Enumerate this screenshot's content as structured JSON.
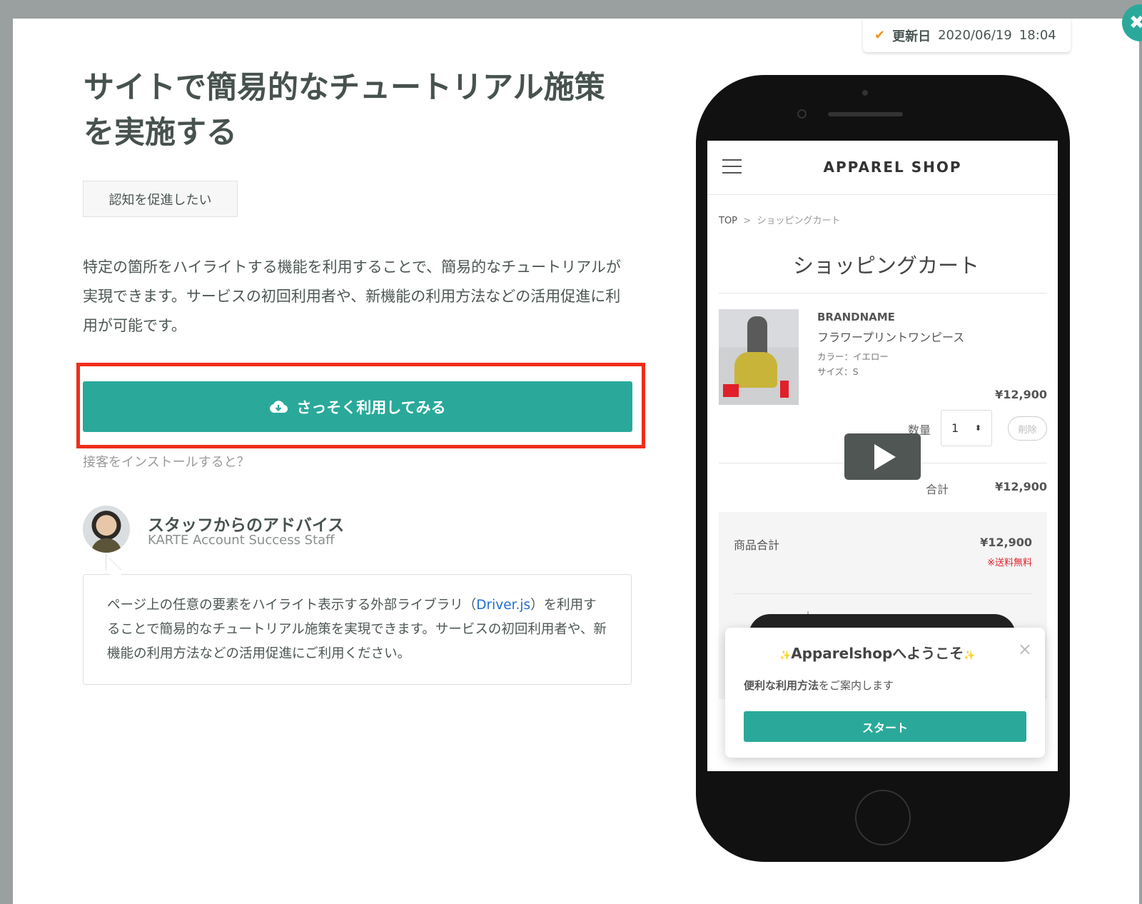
{
  "updated": {
    "label": "更新日",
    "date": "2020/06/19",
    "time": "18:04"
  },
  "close_icon": "✖",
  "title": "サイトで簡易的なチュートリアル施策を実施する",
  "tag": "認知を促進したい",
  "description": "特定の箇所をハイライトする機能を利用することで、簡易的なチュートリアルが実現できます。サービスの初回利用者や、新機能の利用方法などの活用促進に利用が可能です。",
  "cta": {
    "label": "さっそく利用してみる",
    "icon": "cloud-download-icon",
    "color": "#2aa99a"
  },
  "install_link": "接客をインストールすると？",
  "advice": {
    "heading": "スタッフからのアドバイス",
    "role": "KARTE Account Success Staff",
    "text_before": "ページ上の任意の要素をハイライト表示する外部ライブラリ（",
    "link": "Driver.js",
    "text_after": "）を利用することで簡易的なチュートリアル施策を実現できます。サービスの初回利用者や、新機能の利用方法などの活用促進にご利用ください。"
  },
  "phone": {
    "shop_name": "APPAREL SHOP",
    "breadcrumb": {
      "home": "TOP",
      "sep": ">",
      "current": "ショッピングカート"
    },
    "cart_title": "ショッピングカート",
    "item": {
      "brand": "BRANDNAME",
      "name": "フラワープリントワンピース",
      "color": "カラー：イエロー",
      "size": "サイズ：S",
      "price": "¥12,900",
      "qty_label": "数量",
      "qty": "1",
      "delete": "削除"
    },
    "subtotal": {
      "label": "合計",
      "value": "¥12,900"
    },
    "summary": {
      "label": "商品合計",
      "value": "¥12,900",
      "shipping": "※送料無料"
    },
    "popup": {
      "title": "Apparelshopへようこそ",
      "text_bold": "便利な利用方法",
      "text_rest": "をご案内します",
      "button": "スタート",
      "close": "×"
    }
  }
}
